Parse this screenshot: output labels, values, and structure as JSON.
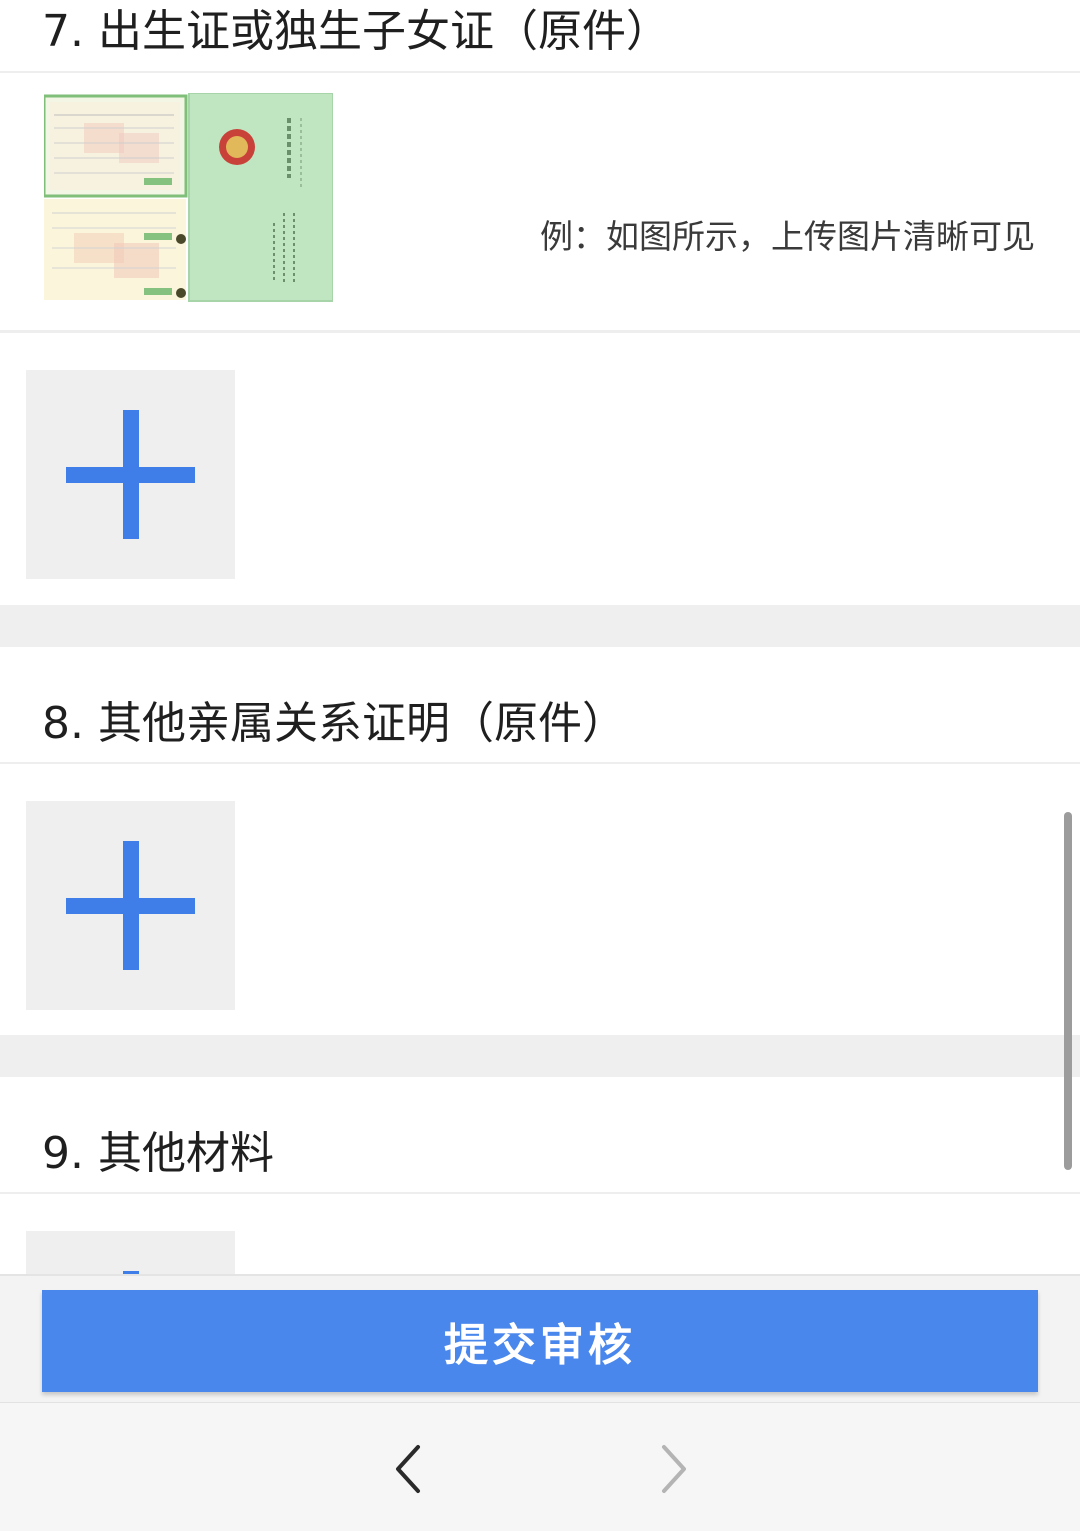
{
  "sections": [
    {
      "title": "7. 出生证或独生子女证（原件）",
      "example_text": "例：如图所示，上传图片清晰可见"
    },
    {
      "title": "8. 其他亲属关系证明（原件）"
    },
    {
      "title": "9. 其他材料"
    }
  ],
  "submit": {
    "label": "提交审核"
  },
  "nav": {
    "back_icon": "chevron-left-icon",
    "forward_icon": "chevron-right-icon"
  },
  "colors": {
    "accent": "#4a87ed",
    "plus": "#3f7ee8"
  }
}
